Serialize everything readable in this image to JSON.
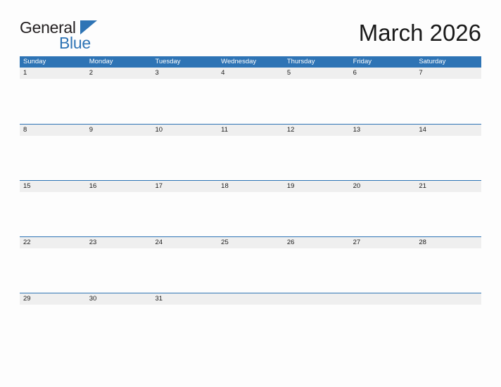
{
  "brand": {
    "name_part1": "General",
    "name_part2": "Blue",
    "flag_icon": "triangle-flag-icon",
    "accent_color": "#2e74b5",
    "text_color": "#231f20"
  },
  "header": {
    "title": "March 2026",
    "month": "March",
    "year": "2026"
  },
  "calendar": {
    "header_bg": "#2e74b5",
    "header_text_color": "#ffffff",
    "day_band_bg": "#efefef",
    "rule_color": "#2e74b5",
    "weekdays": [
      "Sunday",
      "Monday",
      "Tuesday",
      "Wednesday",
      "Thursday",
      "Friday",
      "Saturday"
    ],
    "weeks": [
      {
        "days": [
          {
            "date": "1",
            "events": []
          },
          {
            "date": "2",
            "events": []
          },
          {
            "date": "3",
            "events": []
          },
          {
            "date": "4",
            "events": []
          },
          {
            "date": "5",
            "events": []
          },
          {
            "date": "6",
            "events": []
          },
          {
            "date": "7",
            "events": []
          }
        ]
      },
      {
        "days": [
          {
            "date": "8",
            "events": []
          },
          {
            "date": "9",
            "events": []
          },
          {
            "date": "10",
            "events": []
          },
          {
            "date": "11",
            "events": []
          },
          {
            "date": "12",
            "events": []
          },
          {
            "date": "13",
            "events": []
          },
          {
            "date": "14",
            "events": []
          }
        ]
      },
      {
        "days": [
          {
            "date": "15",
            "events": []
          },
          {
            "date": "16",
            "events": []
          },
          {
            "date": "17",
            "events": []
          },
          {
            "date": "18",
            "events": []
          },
          {
            "date": "19",
            "events": []
          },
          {
            "date": "20",
            "events": []
          },
          {
            "date": "21",
            "events": []
          }
        ]
      },
      {
        "days": [
          {
            "date": "22",
            "events": []
          },
          {
            "date": "23",
            "events": []
          },
          {
            "date": "24",
            "events": []
          },
          {
            "date": "25",
            "events": []
          },
          {
            "date": "26",
            "events": []
          },
          {
            "date": "27",
            "events": []
          },
          {
            "date": "28",
            "events": []
          }
        ]
      },
      {
        "days": [
          {
            "date": "29",
            "events": []
          },
          {
            "date": "30",
            "events": []
          },
          {
            "date": "31",
            "events": []
          },
          {
            "date": "",
            "events": []
          },
          {
            "date": "",
            "events": []
          },
          {
            "date": "",
            "events": []
          },
          {
            "date": "",
            "events": []
          }
        ]
      }
    ]
  }
}
